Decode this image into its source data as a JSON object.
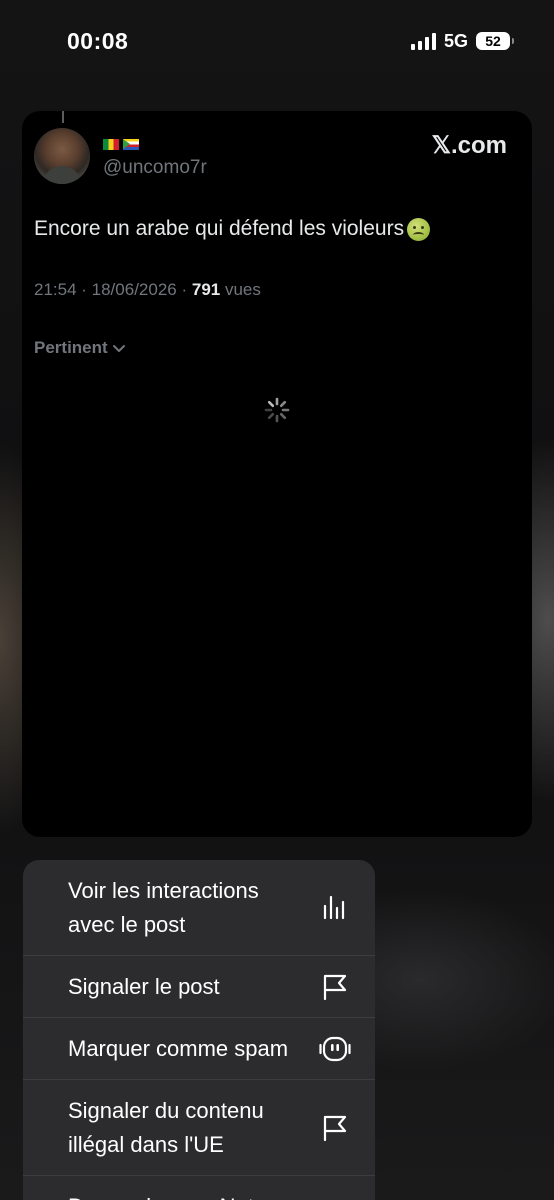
{
  "status_bar": {
    "time": "00:08",
    "network": "5G",
    "battery": "52"
  },
  "post": {
    "handle": "@uncomo7r",
    "flags": [
      "senegal-flag",
      "comoros-flag"
    ],
    "site": "𝕏.com",
    "text": "Encore un arabe qui défend les violeurs",
    "emoji": "nauseated-face",
    "time": "21:54 · 18/06/2026 ·",
    "views_count": "791",
    "views_label": "vues",
    "sort_label": "Pertinent"
  },
  "menu": {
    "items": [
      {
        "line1": "Voir les interactions",
        "line2": "avec le post",
        "icon": "bar-chart-icon"
      },
      {
        "line1": "Signaler le post",
        "icon": "flag-icon"
      },
      {
        "line1": "Marquer comme spam",
        "icon": "robot-icon"
      },
      {
        "line1": "Signaler du contenu",
        "line2": "illégal dans l'UE",
        "icon": "flag-icon"
      },
      {
        "line1": "Demander une Note"
      }
    ]
  },
  "colors": {
    "card_bg": "#000000",
    "menu_bg": "#2c2c2e",
    "secondary_text": "#71767b",
    "primary_text": "#e7e9ea"
  }
}
